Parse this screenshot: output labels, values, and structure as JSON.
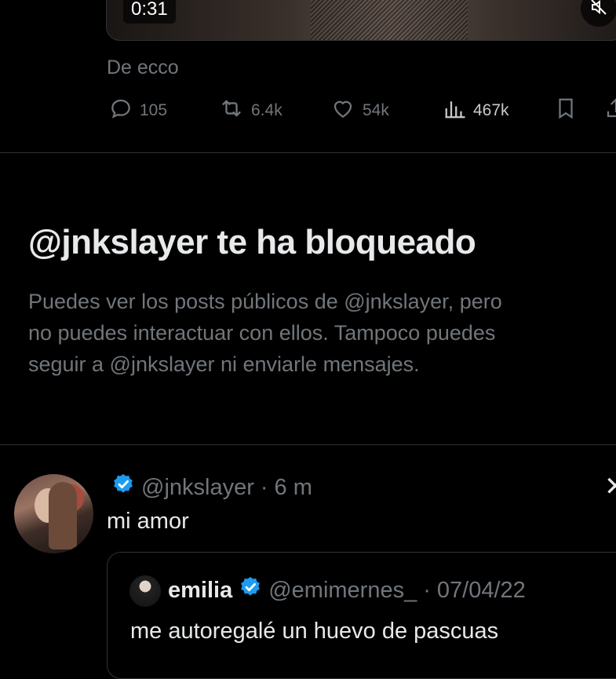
{
  "previous_post": {
    "video_duration": "0:31",
    "source_text": "De ecco",
    "actions": {
      "replies": "105",
      "reposts": "6.4k",
      "likes": "54k",
      "views": "467k"
    }
  },
  "block_notice": {
    "title": "@jnkslayer te ha bloqueado",
    "lines": [
      "Puedes ver los posts públicos de @jnkslayer, pero",
      "no puedes interactuar con ellos. Tampoco puedes",
      "seguir a @jnkslayer ni enviarle mensajes."
    ]
  },
  "reply_post": {
    "handle": "@jnkslayer",
    "separator": "·",
    "time": "6 m",
    "text": "mi amor"
  },
  "quoted_post": {
    "name": "emilia",
    "handle": "@emimernes_",
    "separator": "·",
    "date": "07/04/22",
    "text": "me autoregalé un huevo de pascuas"
  },
  "colors": {
    "background": "#000000",
    "primary_text": "#e7e9ea",
    "secondary_text": "#71767b",
    "verified_blue": "#1d9bf0",
    "divider": "#2f3336"
  }
}
